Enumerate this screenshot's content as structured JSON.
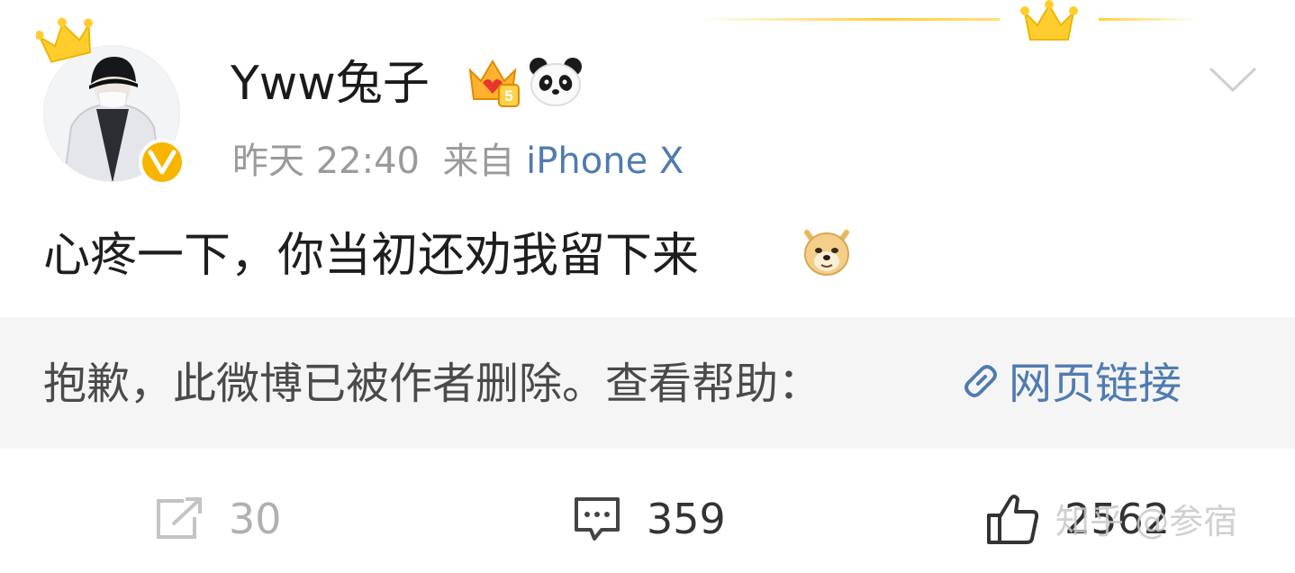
{
  "post": {
    "username": "Yww兔子",
    "time": "昨天 22:40",
    "source_prefix": "来自",
    "source": "iPhone X",
    "text": "心疼一下，你当初还劝我留下来",
    "icons": {
      "avatar_crown": "crown-icon",
      "verified": "verified-v-badge",
      "vip": "vip-crown-level-5-badge",
      "panda": "panda-emoji",
      "doge": "doge-emoji",
      "menu": "chevron-down-icon"
    },
    "vip_level": "5",
    "verified_mark": "V"
  },
  "notice": {
    "text": "抱歉，此微博已被作者删除。查看帮助：",
    "link_label": "网页链接"
  },
  "actions": {
    "repost_count": "30",
    "comment_count": "359",
    "like_count": "2562"
  },
  "watermark": "知乎 @参宿",
  "colors": {
    "link": "#4f7bb0",
    "meta": "#9a9a9a",
    "notice_bg": "#f5f5f5",
    "verified": "#f7b500",
    "crown": "#ffcf3d"
  }
}
